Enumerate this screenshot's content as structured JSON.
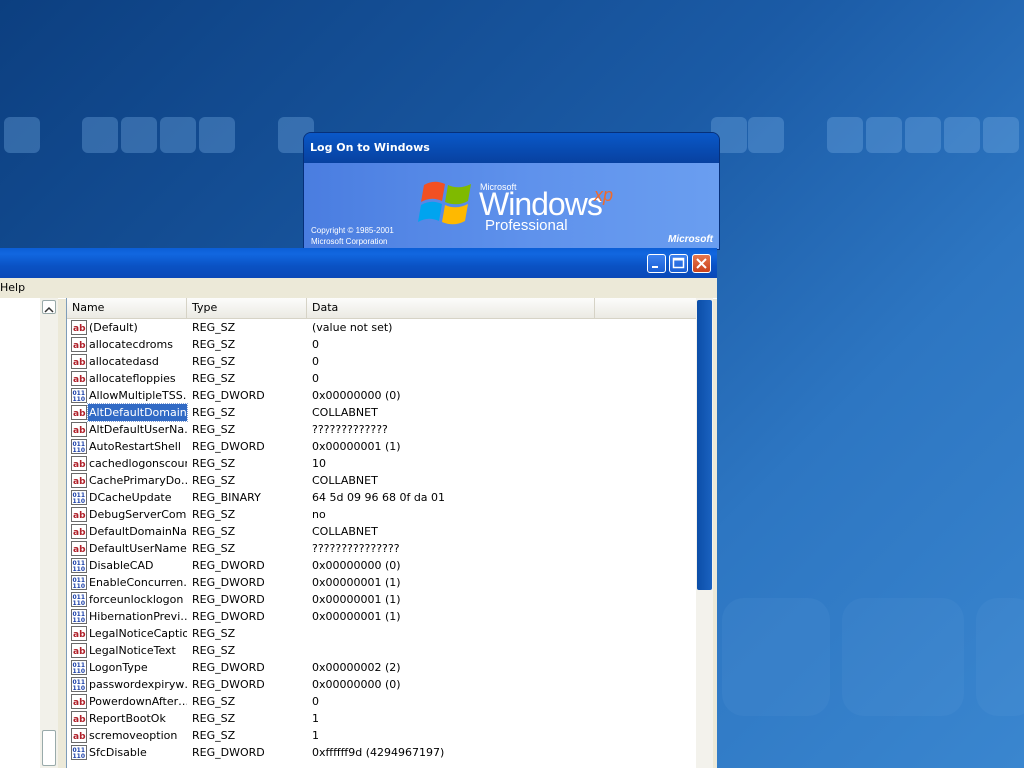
{
  "logon": {
    "title": "Log On to Windows",
    "ms_small": "Microsoft",
    "product_word": "Windows",
    "product_suffix": "xp",
    "edition": "Professional",
    "copyright_line1": "Copyright © 1985-2001",
    "copyright_line2": "Microsoft Corporation",
    "brand": "Microsoft"
  },
  "regedit": {
    "menu_visible": "Help",
    "columns": [
      "Name",
      "Type",
      "Data"
    ],
    "rows": [
      {
        "icon": "string-value-icon",
        "name": "(Default)",
        "type": "REG_SZ",
        "data": "(value not set)"
      },
      {
        "icon": "string-value-icon",
        "name": "allocatecdroms",
        "type": "REG_SZ",
        "data": "0"
      },
      {
        "icon": "string-value-icon",
        "name": "allocatedasd",
        "type": "REG_SZ",
        "data": "0"
      },
      {
        "icon": "string-value-icon",
        "name": "allocatefloppies",
        "type": "REG_SZ",
        "data": "0"
      },
      {
        "icon": "binary-value-icon",
        "name": "AllowMultipleTSS…",
        "type": "REG_DWORD",
        "data": "0x00000000 (0)"
      },
      {
        "icon": "string-value-icon",
        "name": "AltDefaultDomain…",
        "type": "REG_SZ",
        "data": "COLLABNET",
        "selected": true
      },
      {
        "icon": "string-value-icon",
        "name": "AltDefaultUserNa…",
        "type": "REG_SZ",
        "data": "?????????????"
      },
      {
        "icon": "binary-value-icon",
        "name": "AutoRestartShell",
        "type": "REG_DWORD",
        "data": "0x00000001 (1)"
      },
      {
        "icon": "string-value-icon",
        "name": "cachedlogonscount",
        "type": "REG_SZ",
        "data": "10"
      },
      {
        "icon": "string-value-icon",
        "name": "CachePrimaryDo…",
        "type": "REG_SZ",
        "data": "COLLABNET"
      },
      {
        "icon": "binary-value-icon",
        "name": "DCacheUpdate",
        "type": "REG_BINARY",
        "data": "64 5d 09 96 68 0f da 01"
      },
      {
        "icon": "string-value-icon",
        "name": "DebugServerCom…",
        "type": "REG_SZ",
        "data": "no"
      },
      {
        "icon": "string-value-icon",
        "name": "DefaultDomainNa…",
        "type": "REG_SZ",
        "data": "COLLABNET"
      },
      {
        "icon": "string-value-icon",
        "name": "DefaultUserName",
        "type": "REG_SZ",
        "data": "???????????????"
      },
      {
        "icon": "binary-value-icon",
        "name": "DisableCAD",
        "type": "REG_DWORD",
        "data": "0x00000000 (0)"
      },
      {
        "icon": "binary-value-icon",
        "name": "EnableConcurren…",
        "type": "REG_DWORD",
        "data": "0x00000001 (1)"
      },
      {
        "icon": "binary-value-icon",
        "name": "forceunlocklogon",
        "type": "REG_DWORD",
        "data": "0x00000001 (1)"
      },
      {
        "icon": "binary-value-icon",
        "name": "HibernationPrevi…",
        "type": "REG_DWORD",
        "data": "0x00000001 (1)"
      },
      {
        "icon": "string-value-icon",
        "name": "LegalNoticeCaption",
        "type": "REG_SZ",
        "data": ""
      },
      {
        "icon": "string-value-icon",
        "name": "LegalNoticeText",
        "type": "REG_SZ",
        "data": ""
      },
      {
        "icon": "binary-value-icon",
        "name": "LogonType",
        "type": "REG_DWORD",
        "data": "0x00000002 (2)"
      },
      {
        "icon": "binary-value-icon",
        "name": "passwordexpiryw…",
        "type": "REG_DWORD",
        "data": "0x00000000 (0)"
      },
      {
        "icon": "string-value-icon",
        "name": "PowerdownAfter…",
        "type": "REG_SZ",
        "data": "0"
      },
      {
        "icon": "string-value-icon",
        "name": "ReportBootOk",
        "type": "REG_SZ",
        "data": "1"
      },
      {
        "icon": "string-value-icon",
        "name": "scremoveoption",
        "type": "REG_SZ",
        "data": "1"
      },
      {
        "icon": "binary-value-icon",
        "name": "SfcDisable",
        "type": "REG_DWORD",
        "data": "0xffffff9d (4294967197)"
      }
    ]
  }
}
